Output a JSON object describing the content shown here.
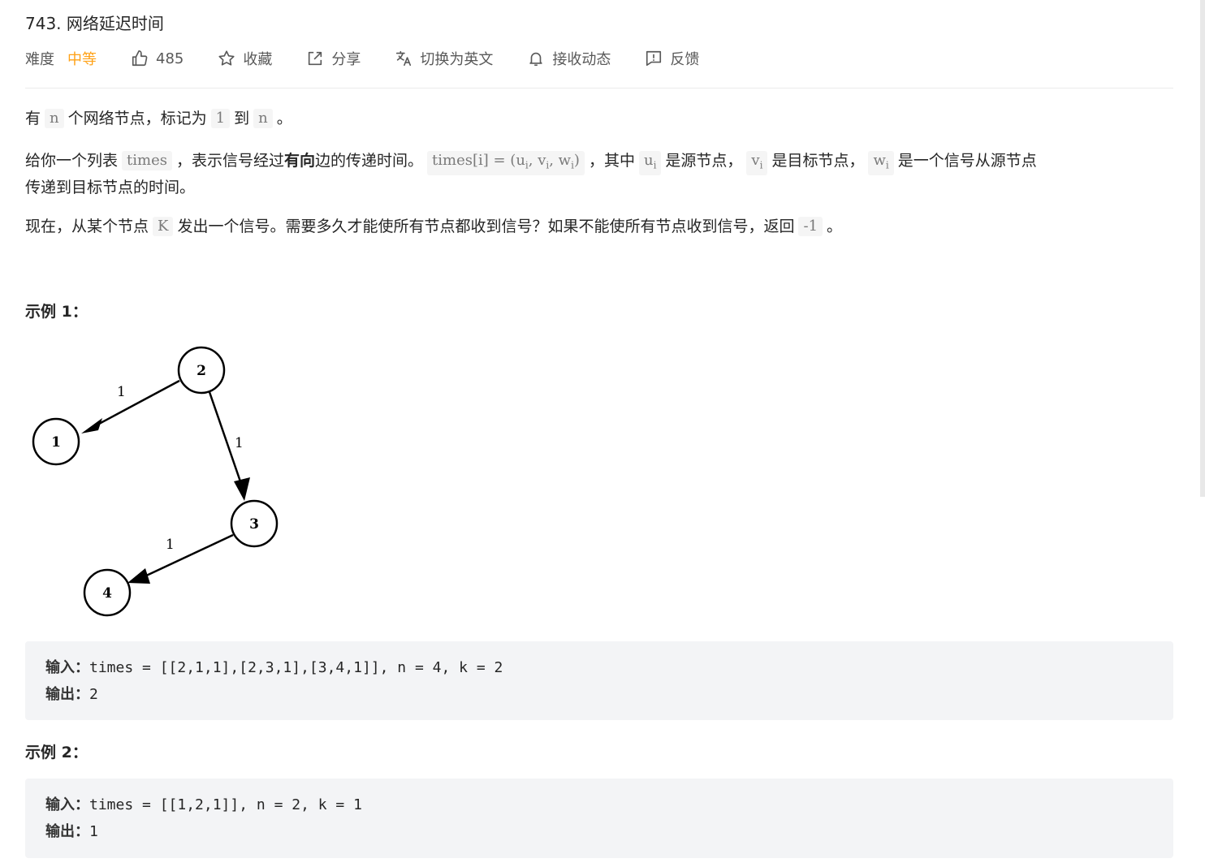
{
  "problem": {
    "title": "743. 网络延迟时间"
  },
  "meta": {
    "difficulty_label": "难度",
    "difficulty_value": "中等",
    "likes": "485",
    "favorite": "收藏",
    "share": "分享",
    "translate": "切换为英文",
    "subscribe": "接收动态",
    "feedback": "反馈"
  },
  "description": {
    "p1": {
      "t1": "有",
      "c1": "n",
      "t2": "个网络节点，标记为",
      "c2": "1",
      "t3": "到",
      "c3": "n",
      "t4": "。"
    },
    "p2": {
      "t1": "给你一个列表",
      "c1": "times",
      "t2": "，表示信号经过",
      "b1": "有向",
      "t3": "边的传递时间。",
      "c2_prefix": "times[i] = (u",
      "c2_sub1": "i",
      "c2_mid1": ", v",
      "c2_sub2": "i",
      "c2_mid2": ", w",
      "c2_sub3": "i",
      "c2_suffix": ")",
      "t4": "，其中",
      "c3": "u",
      "c3_sub": "i",
      "t5": "是源节点，",
      "c4": "v",
      "c4_sub": "i",
      "t6": "是目标节点，",
      "c5": "w",
      "c5_sub": "i",
      "t7": "是一个信号从源节点",
      "t8": "传递到目标节点的时间。"
    },
    "p3": {
      "t1": "现在，从某个节点",
      "c1": "K",
      "t2": "发出一个信号。需要多久才能使所有节点都收到信号？如果不能使所有节点收到信号，返回",
      "c2": "-1",
      "t3": "。"
    }
  },
  "example1": {
    "title": "示例 1：",
    "graph": {
      "nodes": [
        "1",
        "2",
        "3",
        "4"
      ],
      "edges": [
        {
          "from": "2",
          "to": "1",
          "weight": "1"
        },
        {
          "from": "2",
          "to": "3",
          "weight": "1"
        },
        {
          "from": "3",
          "to": "4",
          "weight": "1"
        }
      ]
    },
    "input_label": "输入：",
    "input_value": "times = [[2,1,1],[2,3,1],[3,4,1]], n = 4, k = 2",
    "output_label": "输出：",
    "output_value": "2"
  },
  "example2": {
    "title": "示例 2：",
    "input_label": "输入：",
    "input_value": "times = [[1,2,1]], n = 2, k = 1",
    "output_label": "输出：",
    "output_value": "1"
  },
  "colors": {
    "difficulty_medium": "#ffa116",
    "code_background": "#f5f5f5",
    "pre_background": "#f3f4f6"
  }
}
